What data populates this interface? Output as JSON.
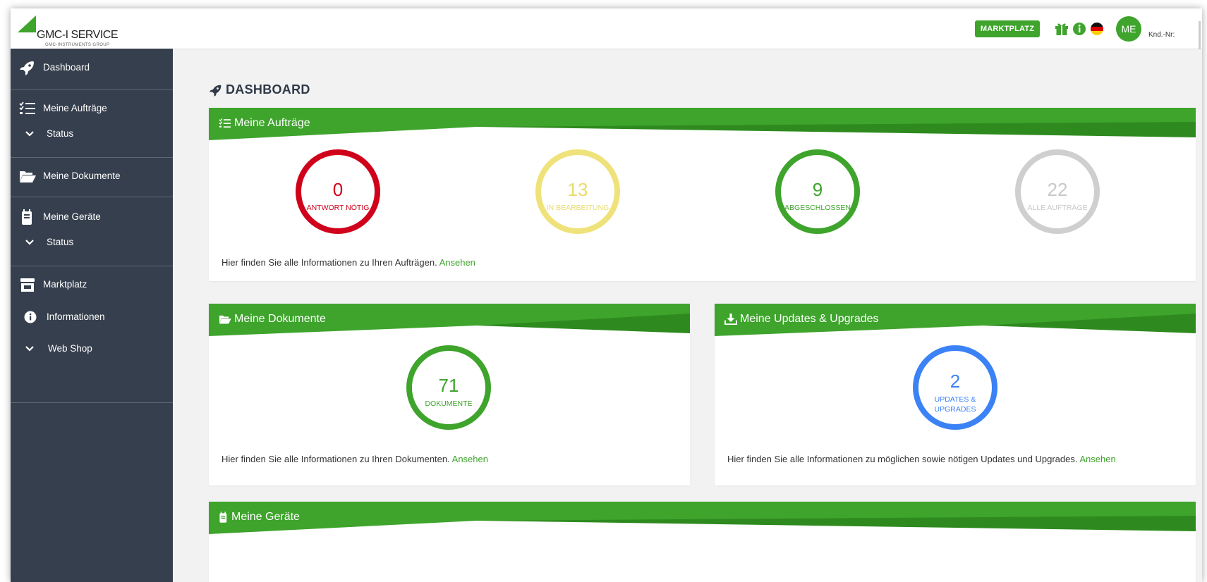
{
  "header": {
    "logo_brand": "GMC-I SERVICE",
    "logo_sub": "GMC-INSTRUMENTS GROUP",
    "market_button": "MARKTPLATZ",
    "icons": [
      "gift-icon",
      "info-icon",
      "german-flag-icon"
    ],
    "avatar_initials": "ME",
    "customer_no_label": "Knd.-Nr:"
  },
  "sidebar": {
    "items": [
      {
        "label": "Dashboard",
        "icon": "rocket-icon"
      },
      {
        "label": "Meine Aufträge",
        "icon": "task-list-icon"
      },
      {
        "label": "Status",
        "icon": "chevron-down-icon"
      },
      {
        "label": "Meine Dokumente",
        "icon": "folder-open-icon"
      },
      {
        "label": "Meine Geräte",
        "icon": "device-icon"
      },
      {
        "label": "Status",
        "icon": "chevron-down-icon"
      },
      {
        "label": "Marktplatz",
        "icon": "store-icon"
      },
      {
        "label": "Informationen",
        "icon": "info-icon"
      },
      {
        "label": "Web Shop",
        "icon": "chevron-down-icon"
      }
    ]
  },
  "page": {
    "title": "DASHBOARD"
  },
  "orders": {
    "title": "Meine Aufträge",
    "stats": [
      {
        "value": "0",
        "label": "ANTWORT NÖTIG",
        "color": "#d0021b"
      },
      {
        "value": "13",
        "label": "IN BEARBEITUNG",
        "color": "#f0e27a"
      },
      {
        "value": "9",
        "label": "ABGESCHLOSSEN",
        "color": "#3ea42c"
      },
      {
        "value": "22",
        "label": "ALLE AUFTRÄGE",
        "color": "#cfcfcf"
      }
    ],
    "info_text": "Hier finden Sie alle Informationen zu Ihren Aufträgen.",
    "link": "Ansehen"
  },
  "documents": {
    "title": "Meine Dokumente",
    "value": "71",
    "label": "DOKUMENTE",
    "color": "#3ea42c",
    "info_text": "Hier finden Sie alle Informationen zu Ihren Dokumenten.",
    "link": "Ansehen"
  },
  "updates": {
    "title": "Meine Updates & Upgrades",
    "value": "2",
    "label": "UPDATES & UPGRADES",
    "color": "#3b82f6",
    "info_text": "Hier finden Sie alle Informationen zu möglichen sowie nötigen Updates und Upgrades.",
    "link": "Ansehen"
  },
  "devices": {
    "title": "Meine Geräte"
  },
  "colors": {
    "accent_green": "#3ea42c",
    "dark_green": "#2e8a1e",
    "sidebar_bg": "#363f4d"
  }
}
